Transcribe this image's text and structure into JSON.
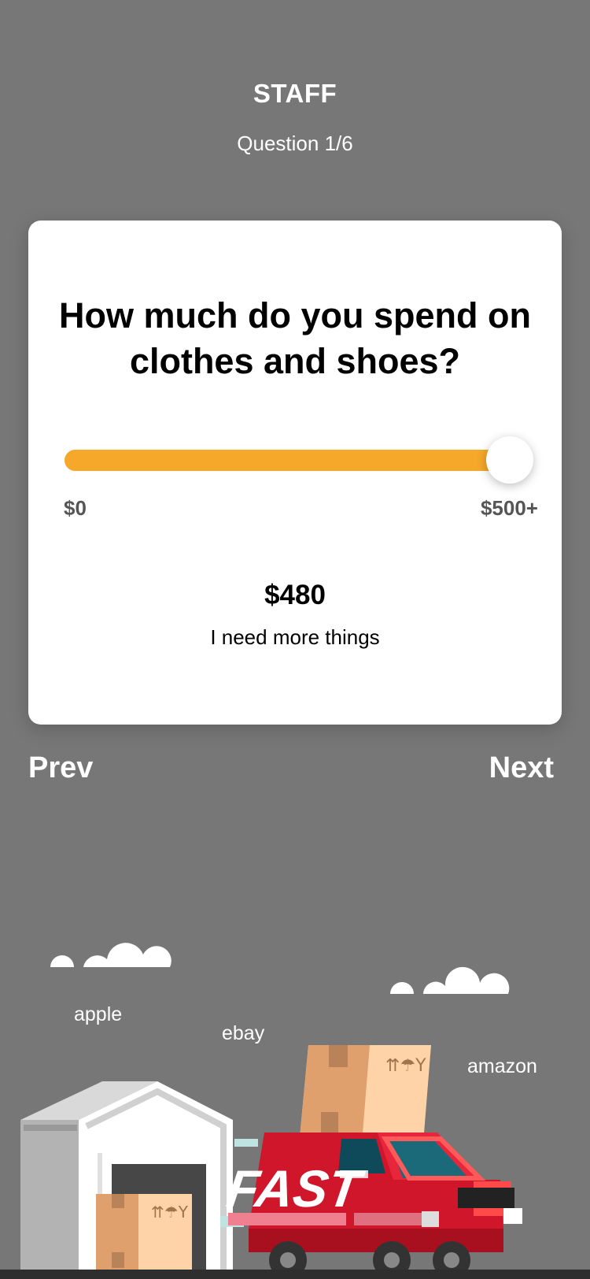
{
  "header": {
    "title": "STAFF",
    "subtitle": "Question 1/6"
  },
  "card": {
    "question": "How much do you spend on clothes and shoes?",
    "slider": {
      "min_label": "$0",
      "max_label": "$500+",
      "min": 0,
      "max": 500,
      "value": 480
    },
    "amount": "$480",
    "comment": "I need more things"
  },
  "nav": {
    "prev": "Prev",
    "next": "Next"
  },
  "illustration": {
    "labels": {
      "apple": "apple",
      "ebay": "ebay",
      "amazon": "amazon"
    },
    "truck_text": "FAST"
  },
  "colors": {
    "background": "#777777",
    "accent": "#f5a82a",
    "truck": "#d0162b"
  }
}
